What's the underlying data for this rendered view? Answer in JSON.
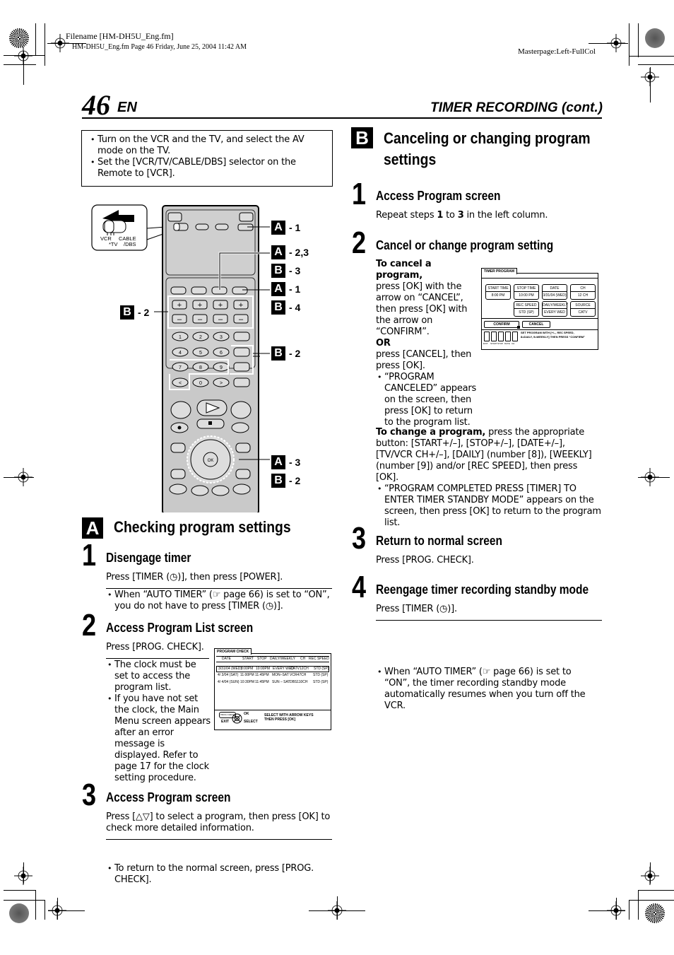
{
  "print_header": {
    "filename": "Filename [HM-DH5U_Eng.fm]",
    "fileinfo": "HM-DH5U_Eng.fm  Page 46  Friday, June 25, 2004  11:42 AM",
    "masterpage": "Masterpage:Left-FullCol"
  },
  "page": {
    "number": "46",
    "lang": "EN",
    "running_title": "TIMER RECORDING (cont.)"
  },
  "prereq_box": {
    "bullets": [
      "Turn on the VCR and the TV, and select the AV mode on the TV.",
      "Set the [VCR/TV/CABLE/DBS] selector on the Remote to [VCR]."
    ]
  },
  "remote": {
    "selector": {
      "labels": [
        "VCR",
        "CABLE",
        "*TV",
        "/DBS"
      ]
    },
    "number_keys": [
      "1",
      "2",
      "3",
      "4",
      "5",
      "6",
      "7",
      "8",
      "9",
      "<",
      "0",
      ">"
    ],
    "plus_label": "+",
    "minus_label": "–",
    "ok_label": "OK",
    "callouts": [
      {
        "letter": "A",
        "text": "- 1"
      },
      {
        "letter": "A",
        "text": "- 2,3"
      },
      {
        "letter": "B",
        "text": "- 3"
      },
      {
        "letter": "A",
        "text": "- 1"
      },
      {
        "letter": "B",
        "text": "- 4"
      },
      {
        "letter": "B",
        "text": "- 2"
      },
      {
        "letter": "B",
        "text": "- 2"
      },
      {
        "letter": "A",
        "text": "- 3"
      },
      {
        "letter": "B",
        "text": "- 2"
      }
    ]
  },
  "section_a": {
    "badge": "A",
    "title": "Checking program settings",
    "steps": [
      {
        "num": "1",
        "title": "Disengage timer",
        "text": "Press [TIMER (◷)], then press [POWER].",
        "notes": [
          "When “AUTO TIMER” (☞ page 66) is set to “ON”, you do not have to press [TIMER (◷)]."
        ]
      },
      {
        "num": "2",
        "title": "Access Program List screen",
        "text": "Press [PROG. CHECK].",
        "notes": [
          "The clock must be set to access the program list.",
          "If you have not set the clock, the Main Menu screen appears after an error message is displayed. Refer to page 17 for the clock setting procedure."
        ]
      },
      {
        "num": "3",
        "title": "Access Program screen",
        "text": "Press [△▽] to select a program, then press [OK] to check more detailed information.",
        "notes": [
          "To return to the normal screen, press [PROG. CHECK]."
        ]
      }
    ]
  },
  "program_check_screen": {
    "tab": "PROGRAM CHECK",
    "headers": [
      "DATE",
      "START",
      "STOP",
      "DAILY/WEEKLY",
      "CH",
      "REC SPEED"
    ],
    "rows": [
      {
        "date": "3/31/04 (WED)",
        "start": "8:00PM",
        "stop": "10:00PM",
        "daily": "EVERY WED",
        "ch": "CATV12CH",
        "speed": "STD (SP)",
        "selected": true
      },
      {
        "date": "4/  3/04 (SAT)",
        "start": "11:00PM",
        "stop": "11:45PM",
        "daily": "MON–SAT",
        "ch": "VCR47CH",
        "speed": "STD (SP)",
        "selected": false
      },
      {
        "date": "4/  4/04 (SUN)",
        "start": "10:30PM",
        "stop": "11:45PM",
        "daily": "SUN – SAT",
        "ch": "DBS110CH",
        "speed": "STD (SP)",
        "selected": false
      }
    ],
    "footer": {
      "exit_key": "PROG CHECK",
      "exit": "EXIT",
      "ok": "OK",
      "select": "SELECT",
      "instruction": "SELECT WITH ARROW KEYS THEN PRESS [OK]"
    }
  },
  "section_b": {
    "badge": "B",
    "title_line1": "Canceling or changing program",
    "title_line2": "settings",
    "steps": [
      {
        "num": "1",
        "title": "Access Program screen",
        "text_pre": "Repeat steps ",
        "b1": "1",
        "text_mid": " to ",
        "b2": "3",
        "text_post": " in the left column."
      },
      {
        "num": "2",
        "title": "Cancel or change program setting",
        "cancel_lead": "To cancel a program,",
        "cancel_text": "press [OK] with the arrow on “CANCEL”, then press [OK] with the arrow on “CONFIRM”.",
        "or": "OR",
        "cancel_alt": "press [CANCEL],  then press [OK].",
        "cancel_note": "“PROGRAM CANCELED” appears on the screen, then press [OK] to return to the program list.",
        "change_lead": "To change a program,",
        "change_text": " press the appropriate button: [START+/–], [STOP+/–], [DATE+/–], [TV/VCR CH+/–], [DAILY] (number [8]), [WEEKLY] (number [9]) and/or [REC SPEED], then press [OK].",
        "change_note": "“PROGRAM COMPLETED PRESS [TIMER] TO ENTER TIMER STANDBY MODE” appears on the screen, then press [OK] to return to the program list."
      },
      {
        "num": "3",
        "title": "Return to normal screen",
        "text": "Press [PROG. CHECK]."
      },
      {
        "num": "4",
        "title": "Reengage timer recording standby mode",
        "text": "Press [TIMER (◷)].",
        "notes": [
          "When “AUTO TIMER” (☞ page 66) is set to “ON”, the timer recording standby mode automatically resumes when you turn off the VCR."
        ]
      }
    ]
  },
  "timer_program_screen": {
    "tab": "TIMER PROGRAM",
    "fields": [
      {
        "label": "START TIME",
        "value": "8:00 PM"
      },
      {
        "label": "STOP TIME",
        "value": "10:00  PM"
      },
      {
        "label": "DATE",
        "value": "3/31/04 (WED)"
      },
      {
        "label": "CH",
        "value": "12 CH"
      },
      {
        "label": "REC SPEED",
        "value": "STD (SP)"
      },
      {
        "label": "DAILY/WEEKLY",
        "value": "EVERY WED"
      },
      {
        "label": "SOURCE",
        "value": "CATV"
      }
    ],
    "confirm": "CONFIRM",
    "cancel": "CANCEL",
    "key_labels": [
      "EXIT",
      "START",
      "STOP",
      "DATE",
      "CH"
    ],
    "instruction_line1": "SET PROGRAM WITH [+/–, REC SPEED,",
    "instruction_line2": "8=DAILY, 9=WEEKLY] THEN PRESS “CONFIRM”"
  }
}
